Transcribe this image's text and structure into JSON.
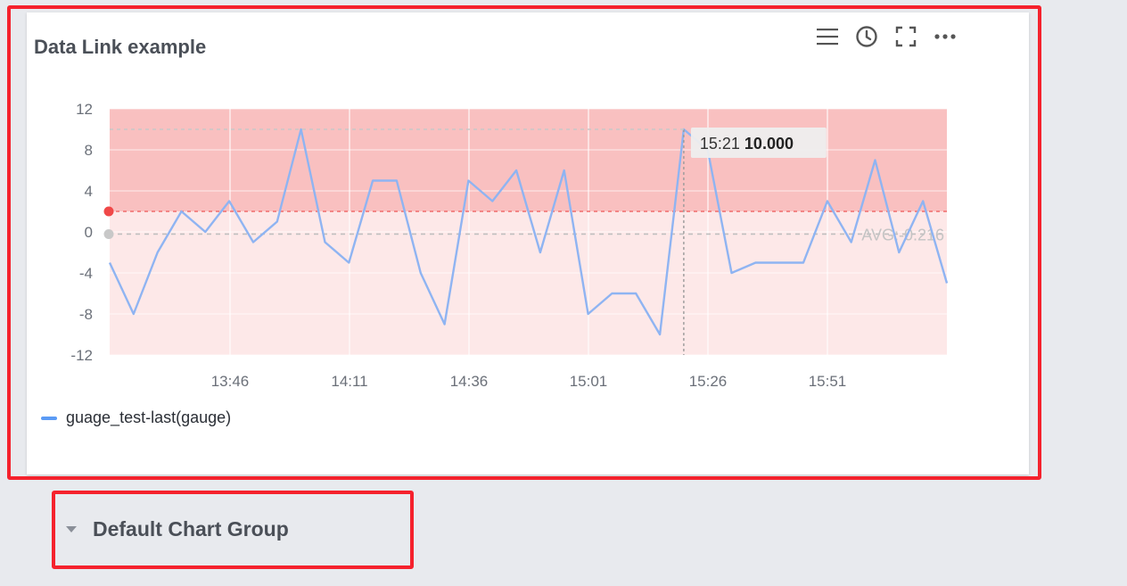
{
  "panel": {
    "title": "Data Link example",
    "toolbar": [
      {
        "icon": "menu-icon"
      },
      {
        "icon": "clock-icon"
      },
      {
        "icon": "fullscreen-icon"
      },
      {
        "icon": "more-icon"
      }
    ]
  },
  "group": {
    "title": "Default Chart Group"
  },
  "colors": {
    "series": "#8fb4f2",
    "threshold_line": "#f06c6c",
    "band_upper": "#f9c0c0",
    "band_lower": "#fde8e8",
    "avg_line": "#bfbfbf"
  },
  "chart_data": {
    "type": "line",
    "x_tick_labels": [
      "13:46",
      "14:11",
      "14:36",
      "15:01",
      "15:26",
      "15:51"
    ],
    "y_ticks": [
      12,
      8,
      4,
      0,
      -4,
      -8,
      -12
    ],
    "ylim": [
      -12,
      12
    ],
    "series": [
      {
        "name": "guage_test-last(gauge)",
        "values": [
          -3,
          -8,
          -2,
          2,
          0,
          3,
          -1,
          1,
          10,
          -1,
          -3,
          5,
          5,
          -4,
          -9,
          5,
          3,
          6,
          -2,
          6,
          -8,
          -6,
          -6,
          -10,
          10,
          8,
          -4,
          -3,
          -3,
          -3,
          3,
          -1,
          7,
          -2,
          3,
          -5
        ]
      }
    ],
    "threshold": 2,
    "average": {
      "label": "AVG:-0.216",
      "value": -0.216
    },
    "tooltip": {
      "time": "15:21",
      "value": "10.000",
      "index": 24
    }
  }
}
